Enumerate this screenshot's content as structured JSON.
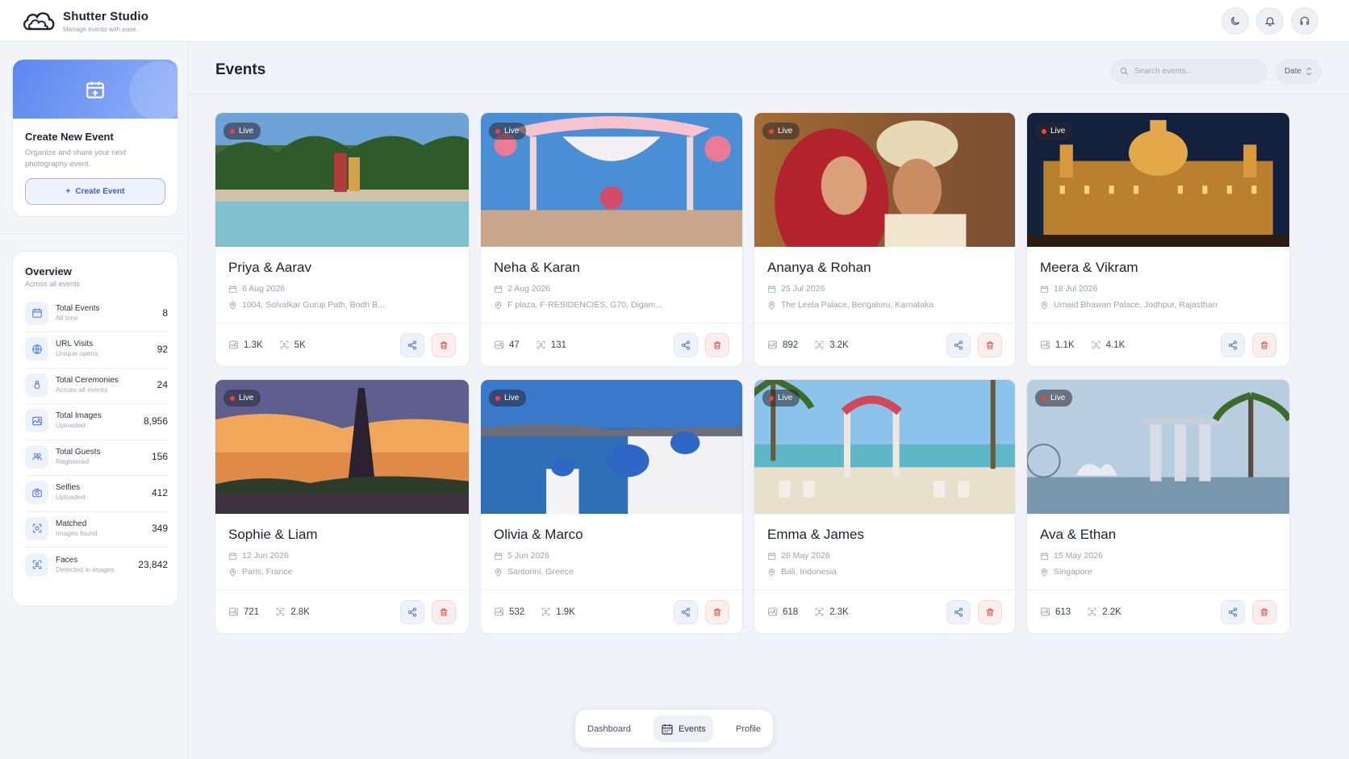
{
  "app": {
    "name": "Shutter Studio",
    "tagline": "Manage events with ease."
  },
  "top_actions": [
    "moon-icon",
    "bell-icon",
    "headset-icon"
  ],
  "create": {
    "title": "Create New Event",
    "description": "Organize and share your next photography event.",
    "button": "Create Event"
  },
  "overview": {
    "title": "Overview",
    "subtitle": "Across all events",
    "stats": [
      {
        "label": "Total Events",
        "sub": "All time",
        "value": "8",
        "icon": "calendar-icon"
      },
      {
        "label": "URL Visits",
        "sub": "Unique opens",
        "value": "92",
        "icon": "globe-icon"
      },
      {
        "label": "Total Ceremonies",
        "sub": "Across all events",
        "value": "24",
        "icon": "rings-icon"
      },
      {
        "label": "Total Images",
        "sub": "Uploaded",
        "value": "8,956",
        "icon": "image-icon"
      },
      {
        "label": "Total Guests",
        "sub": "Registered",
        "value": "156",
        "icon": "users-icon"
      },
      {
        "label": "Selfies",
        "sub": "Uploaded",
        "value": "412",
        "icon": "camera-icon"
      },
      {
        "label": "Matched",
        "sub": "Images found",
        "value": "349",
        "icon": "match-icon"
      },
      {
        "label": "Faces",
        "sub": "Detected in images",
        "value": "23,842",
        "icon": "face-scan-icon"
      }
    ]
  },
  "events_page": {
    "title": "Events",
    "search_placeholder": "Search events...",
    "sort_label": "Date"
  },
  "badge_label": "Live",
  "events": [
    {
      "title": "Priya & Aarav",
      "date": "6 Aug 2026",
      "location": "1004, Solvalkar Guruji Path, Bodh B...",
      "images": "1.3K",
      "faces": "5K",
      "scene": "garden-pool"
    },
    {
      "title": "Neha & Karan",
      "date": "2 Aug 2026",
      "location": "F plaza, F-RESIDENCIES, G70, Digam...",
      "images": "47",
      "faces": "131",
      "scene": "mandap"
    },
    {
      "title": "Ananya & Rohan",
      "date": "25 Jul 2026",
      "location": "The Leela Palace, Bengaluru, Karnataka",
      "images": "892",
      "faces": "3.2K",
      "scene": "couple"
    },
    {
      "title": "Meera & Vikram",
      "date": "18 Jul 2026",
      "location": "Umaid Bhawan Palace, Jodhpur, Rajasthan",
      "images": "1.1K",
      "faces": "4.1K",
      "scene": "palace-night"
    },
    {
      "title": "Sophie & Liam",
      "date": "12 Jun 2026",
      "location": "Paris, France",
      "images": "721",
      "faces": "2.8K",
      "scene": "eiffel-sunset"
    },
    {
      "title": "Olivia & Marco",
      "date": "5 Jun 2026",
      "location": "Santorini, Greece",
      "images": "532",
      "faces": "1.9K",
      "scene": "santorini"
    },
    {
      "title": "Emma & James",
      "date": "28 May 2026",
      "location": "Bali, Indonesia",
      "images": "618",
      "faces": "2.3K",
      "scene": "beach-arch"
    },
    {
      "title": "Ava & Ethan",
      "date": "15 May 2026",
      "location": "Singapore",
      "images": "613",
      "faces": "2.2K",
      "scene": "marina-bay"
    }
  ],
  "bottom_nav": {
    "items": [
      "Dashboard",
      "Events",
      "Profile"
    ],
    "active": "Events"
  },
  "colors": {
    "accent": "#4f7be8",
    "danger": "#e05252",
    "live_dot": "#ff3b3b",
    "background": "#f1f3f8"
  }
}
